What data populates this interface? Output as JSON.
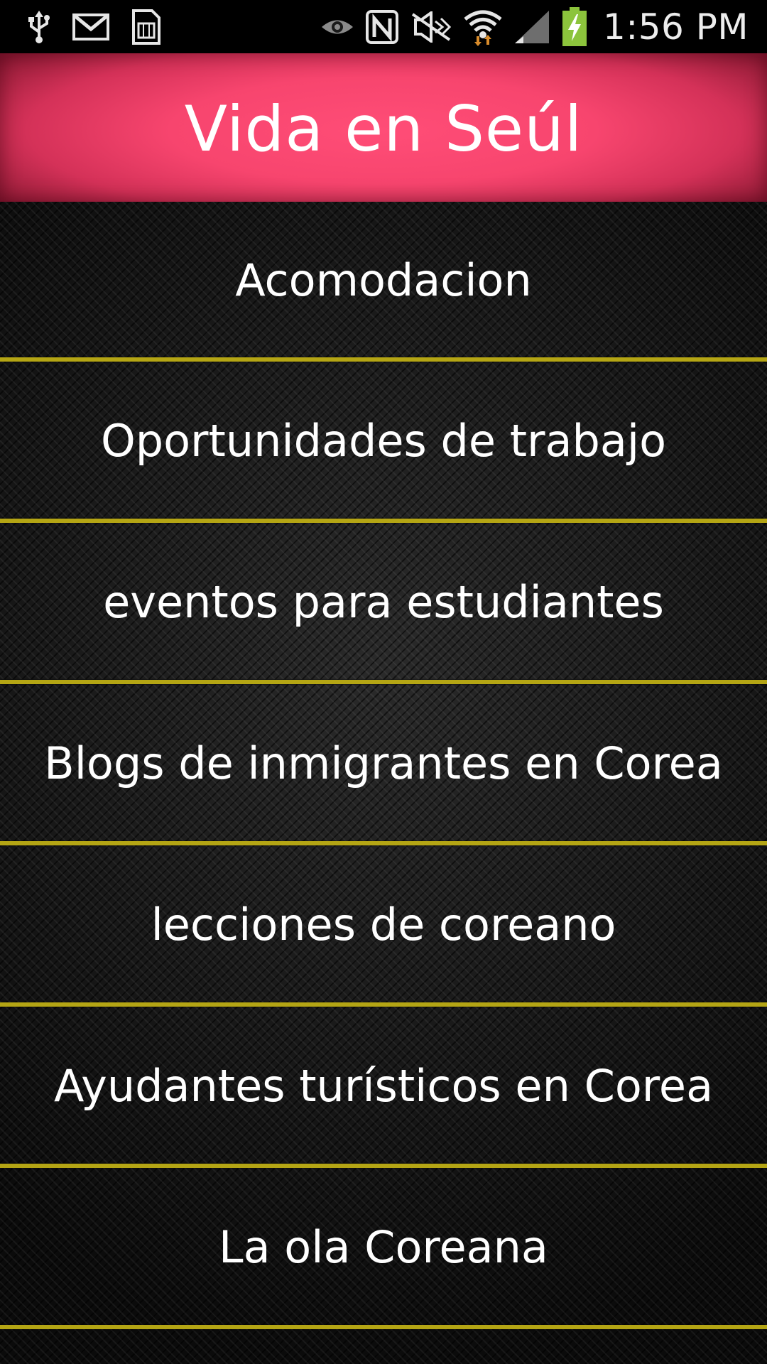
{
  "status_bar": {
    "time": "1:56 PM",
    "left_icons": [
      "usb-icon",
      "gmail-icon",
      "sim-card-icon"
    ],
    "right_icons": [
      "eye-icon",
      "nfc-icon",
      "mute-icon",
      "wifi-icon",
      "signal-icon",
      "battery-charging-icon"
    ],
    "battery_color": "#8cc43c"
  },
  "header": {
    "title": "Vida en Seúl",
    "color": "#ff4d77"
  },
  "menu": {
    "items": [
      {
        "label": "Acomodacion"
      },
      {
        "label": "Oportunidades de trabajo"
      },
      {
        "label": "eventos para estudiantes"
      },
      {
        "label": "Blogs de inmigrantes en Corea"
      },
      {
        "label": "lecciones de coreano"
      },
      {
        "label": "Ayudantes turísticos en Corea"
      },
      {
        "label": "La ola Coreana"
      }
    ],
    "divider_color": "#b4a514"
  }
}
